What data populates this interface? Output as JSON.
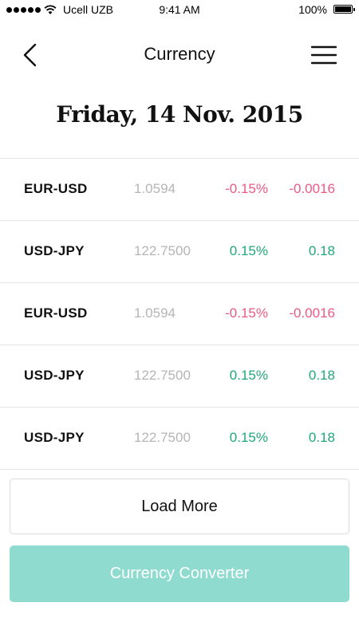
{
  "status_bar": {
    "carrier": "Ucell UZB",
    "time": "9:41 AM",
    "battery": "100%"
  },
  "header": {
    "title": "Currency",
    "back_icon": "chevron-left-icon",
    "menu_icon": "hamburger-menu-icon"
  },
  "date": "Friday, 14 Nov. 2015",
  "rates": [
    {
      "pair": "EUR-USD",
      "rate": "1.0594",
      "percent": "-0.15%",
      "change": "-0.0016",
      "trend": "neg"
    },
    {
      "pair": "USD-JPY",
      "rate": "122.7500",
      "percent": "0.15%",
      "change": "0.18",
      "trend": "pos"
    },
    {
      "pair": "EUR-USD",
      "rate": "1.0594",
      "percent": "-0.15%",
      "change": "-0.0016",
      "trend": "neg"
    },
    {
      "pair": "USD-JPY",
      "rate": "122.7500",
      "percent": "0.15%",
      "change": "0.18",
      "trend": "pos"
    },
    {
      "pair": "USD-JPY",
      "rate": "122.7500",
      "percent": "0.15%",
      "change": "0.18",
      "trend": "pos"
    }
  ],
  "buttons": {
    "load_more": "Load More",
    "converter": "Currency Converter"
  },
  "colors": {
    "negative": "#ec5a84",
    "positive": "#1fa77a",
    "accent": "#8fdbcf"
  }
}
